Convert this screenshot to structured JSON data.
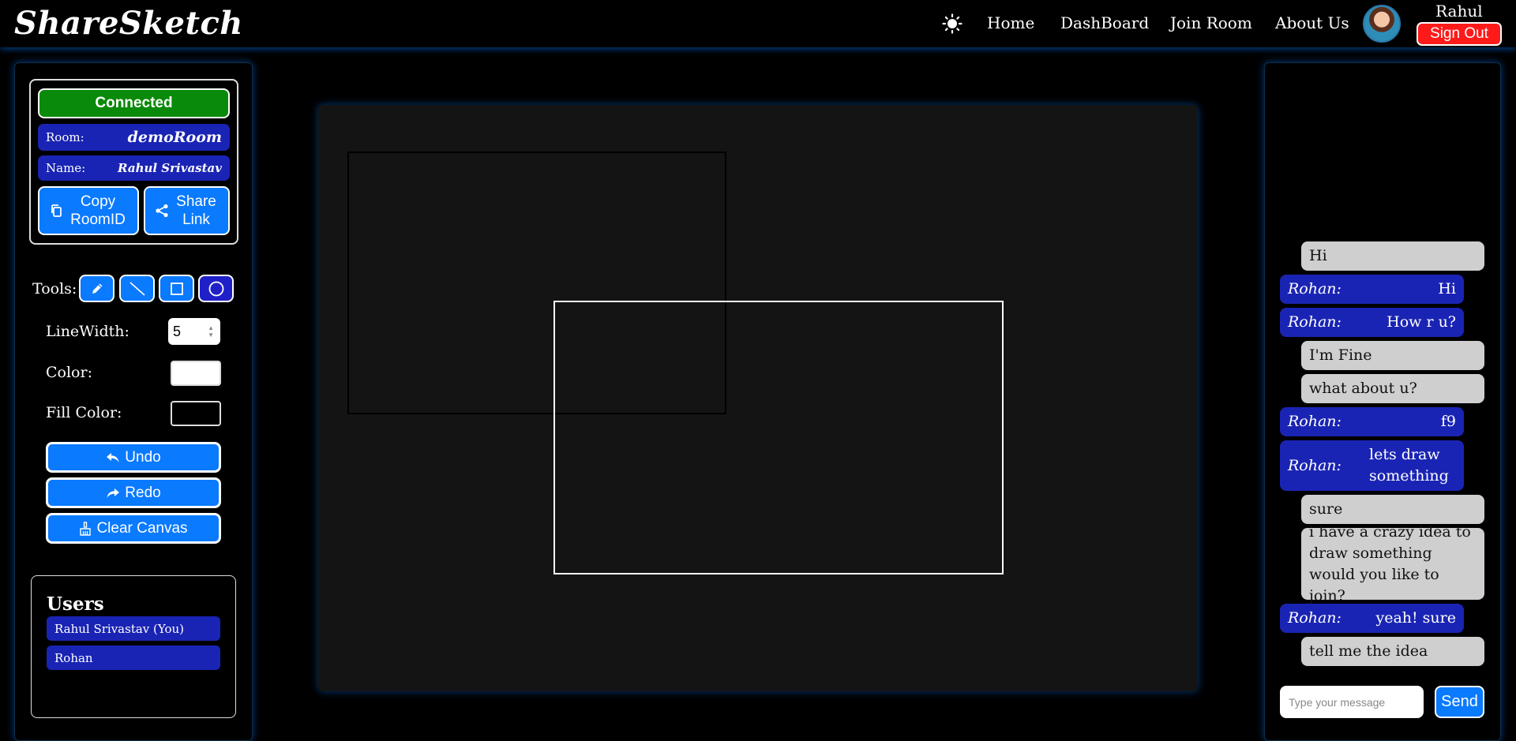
{
  "header": {
    "brand": "ShareSketch",
    "theme_icon": "sun-icon",
    "nav": [
      "Home",
      "DashBoard",
      "Join Room",
      "About Us"
    ],
    "user_name": "Rahul",
    "sign_out_label": "Sign Out"
  },
  "room": {
    "status": "Connected",
    "room_label": "Room:",
    "room_value": "demoRoom",
    "name_label": "Name:",
    "name_value": "Rahul Srivastav",
    "copy_label": "Copy RoomID",
    "share_label": "Share Link"
  },
  "tools": {
    "label": "Tools:",
    "items": [
      {
        "name": "pencil-icon",
        "active": false
      },
      {
        "name": "line-icon",
        "active": false
      },
      {
        "name": "rectangle-icon",
        "active": false
      },
      {
        "name": "circle-icon",
        "active": true
      }
    ]
  },
  "settings": {
    "line_width_label": "LineWidth:",
    "line_width_value": "5",
    "color_label": "Color:",
    "color_value": "#ffffff",
    "fill_label": "Fill Color:",
    "fill_value": "#000000"
  },
  "actions": {
    "undo": "Undo",
    "redo": "Redo",
    "clear": "Clear Canvas"
  },
  "users": {
    "title": "Users",
    "list": [
      "Rahul Srivastav (You)",
      "Rohan"
    ]
  },
  "chat": {
    "messages": [
      {
        "type": "me",
        "text": "Hi"
      },
      {
        "type": "other",
        "sender": "Rohan:",
        "text": "Hi"
      },
      {
        "type": "other",
        "sender": "Rohan:",
        "text": "How r u?"
      },
      {
        "type": "me",
        "text": "I'm Fine"
      },
      {
        "type": "me",
        "text": "what about u?"
      },
      {
        "type": "other",
        "sender": "Rohan:",
        "text": "f9"
      },
      {
        "type": "other",
        "sender": "Rohan:",
        "text": "lets draw something"
      },
      {
        "type": "me",
        "text": "sure"
      },
      {
        "type": "me",
        "text": "i have a crazy idea to draw something would you like to join?"
      },
      {
        "type": "other",
        "sender": "Rohan:",
        "text": "yeah! sure"
      },
      {
        "type": "me",
        "text": "tell me the idea"
      }
    ],
    "input_placeholder": "Type your message",
    "send_label": "Send"
  },
  "colors": {
    "accent": "#0a7aff",
    "room_blue": "#1a24b4",
    "connected_green": "#0a8a0a",
    "sign_out_red": "#ff1a1a",
    "canvas_bg": "#141414"
  }
}
